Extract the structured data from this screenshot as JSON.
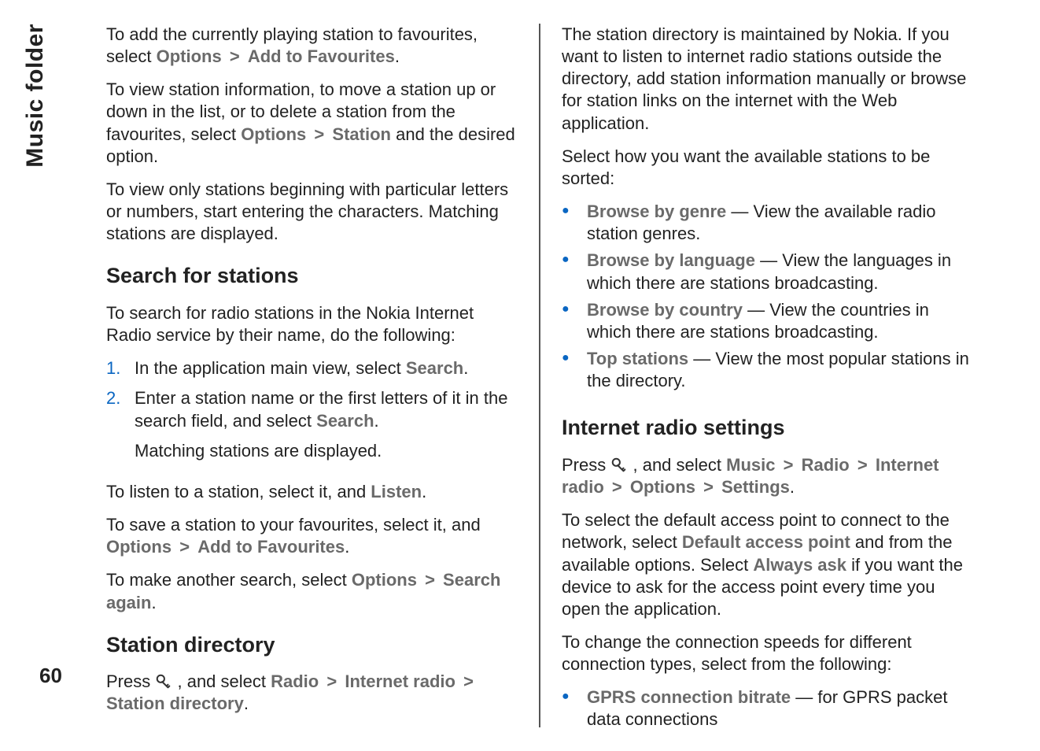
{
  "sideLabel": "Music folder",
  "pageNumber": "60",
  "left": {
    "p1_a": "To add the currently playing station to favourites, select ",
    "p1_opt": "Options",
    "p1_add": "Add to Favourites",
    "p1_end": ".",
    "p2_a": "To view station information, to move a station up or down in the list, or to delete a station from the favourites, select ",
    "p2_opt": "Options",
    "p2_station": "Station",
    "p2_b": " and the desired option.",
    "p3": "To view only stations beginning with particular letters or numbers, start entering the characters. Matching stations are displayed.",
    "h_search": "Search for stations",
    "p4": "To search for radio stations in the Nokia Internet Radio service by their name, do the following:",
    "ol1_num": "1.",
    "ol1_a": "In the application main view, select ",
    "ol1_search": "Search",
    "ol1_end": ".",
    "ol2_num": "2.",
    "ol2_a": "Enter a station name or the first letters of it in the search field, and select ",
    "ol2_search": "Search",
    "ol2_end": ".",
    "ol2_sub": "Matching stations are displayed.",
    "p5_a": "To listen to a station, select it, and ",
    "p5_listen": "Listen",
    "p5_end": ".",
    "p6_a": "To save a station to your favourites, select it, and ",
    "p6_opt": "Options",
    "p6_add": "Add to Favourites",
    "p6_end": ".",
    "p7_a": "To make another search, select ",
    "p7_opt": "Options",
    "p7_search": "Search again",
    "p7_end": ".",
    "h_dir": "Station directory",
    "p8_a": "Press ",
    "p8_b": " , and select ",
    "p8_radio": "Radio",
    "p8_ir": "Internet radio",
    "p8_sd": "Station directory",
    "p8_end": "."
  },
  "right": {
    "p1": "The station directory is maintained by Nokia. If you want to listen to internet radio stations outside the directory, add station information manually or browse for station links on the internet with the Web application.",
    "p2": "Select how you want the available stations to be sorted:",
    "b1_label": "Browse by genre",
    "b1_text": " — View the available radio station genres.",
    "b2_label": "Browse by language",
    "b2_text": " — View the languages in which there are stations broadcasting.",
    "b3_label": "Browse by country",
    "b3_text": " — View the countries in which there are stations broadcasting.",
    "b4_label": "Top stations",
    "b4_text": " — View the most popular stations in the directory.",
    "h_settings": "Internet radio settings",
    "p3_a": "Press ",
    "p3_b": " , and select ",
    "p3_music": "Music",
    "p3_radio": "Radio",
    "p3_ir": "Internet radio",
    "p3_opt": "Options",
    "p3_settings": "Settings",
    "p3_end": ".",
    "p4_a": "To select the default access point to connect to the network, select ",
    "p4_dap": "Default access point",
    "p4_b": " and from the available options. Select ",
    "p4_ask": "Always ask",
    "p4_c": " if you want the device to ask for the access point every time you open the application.",
    "p5": "To change the connection speeds for different connection types, select from the following:",
    "b5_label": "GPRS connection bitrate",
    "b5_text": " — for GPRS packet data connections"
  },
  "gt": ">"
}
